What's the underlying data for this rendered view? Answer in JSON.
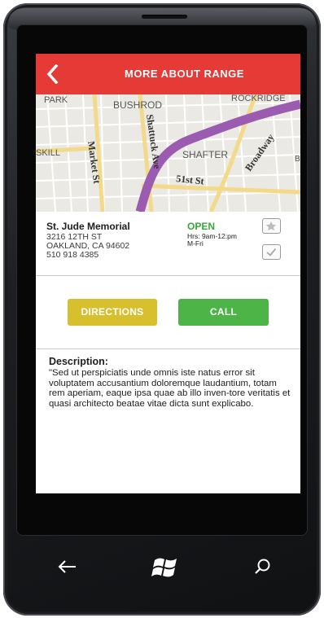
{
  "header": {
    "title": "MORE ABOUT RANGE"
  },
  "map": {
    "labels": {
      "park": "PARK",
      "bushrod": "BUSHROD",
      "rockridge": "ROCKRIDGE",
      "shattuck": "Shattuck Ave",
      "skill": "SKILL",
      "market": "Market St",
      "shafter": "SHAFTER",
      "broadway": "Broadway",
      "fifty_first": "51st St",
      "edge": "Be"
    }
  },
  "place": {
    "name": "St. Jude Memorial",
    "address_line1": "3216 12TH ST",
    "address_line2": "OAKLAND, CA 94602",
    "phone": "510 918 4385",
    "status": "OPEN",
    "hours_line1": "Hrs: 9am-12:pm",
    "hours_line2": "M-Fri"
  },
  "actions": {
    "directions_label": "DIRECTIONS",
    "call_label": "CALL"
  },
  "description": {
    "title": "Description:",
    "body": "\"Sed ut perspiciatis unde omnis iste natus error sit voluptatem accusantium doloremque laudantium, totam rem aperiam, eaque ipsa quae ab illo inven-tore veritatis et quasi architecto beatae vitae dicta sunt explicabo."
  },
  "colors": {
    "header": "#e53a36",
    "open": "#3aa63a",
    "directions": "#d8bf2e",
    "call": "#4db548",
    "route": "#9b5bb0"
  },
  "icons": {
    "back": "chevron-left-icon",
    "favorite": "star-icon",
    "checkin": "check-icon",
    "nav_back": "back-arrow-icon",
    "nav_start": "windows-logo-icon",
    "nav_search": "search-icon"
  }
}
